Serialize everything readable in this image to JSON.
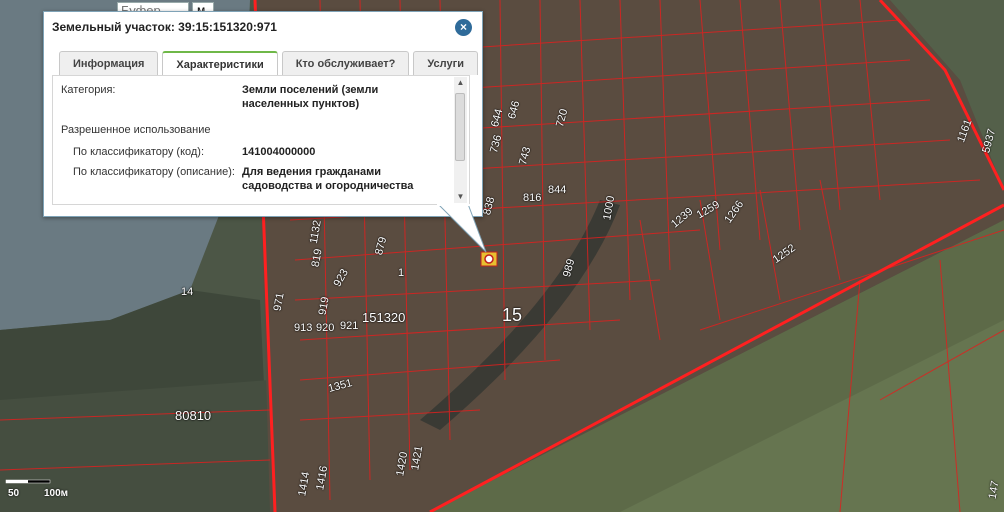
{
  "buffer": {
    "placeholder": "Буфер",
    "unit": "м."
  },
  "popup": {
    "title": "Земельный участок: 39:15:151320:971",
    "close_symbol": "×",
    "tabs": [
      {
        "label": "Информация",
        "active": false
      },
      {
        "label": "Характеристики",
        "active": true
      },
      {
        "label": "Кто обслуживает?",
        "active": false
      },
      {
        "label": "Услуги",
        "active": false
      }
    ],
    "rows": {
      "category_label": "Категория:",
      "category_value_1": "Земли поселений (земли",
      "category_value_2": "населенных пунктов)",
      "permitted_use_label": "Разрешенное использование",
      "classifier_code_label": "По классификатору (код):",
      "classifier_code_value": "141004000000",
      "classifier_desc_label": "По классификатору (описание):",
      "classifier_desc_value_1": "Для ведения гражданами",
      "classifier_desc_value_2": "садоводства и огородничества"
    }
  },
  "map": {
    "labels": [
      "646",
      "644",
      "736",
      "720",
      "743",
      "816",
      "844",
      "1000",
      "1239",
      "1259",
      "1266",
      "1161",
      "5937",
      "838",
      "879",
      "1",
      "923",
      "1132",
      "819",
      "14",
      "971",
      "919",
      "913",
      "920",
      "921",
      "151320",
      "15",
      "989",
      "1252",
      "1351",
      "80810",
      "1421",
      "1420",
      "1416",
      "1414",
      "147"
    ],
    "parcel_color": "#e0201e",
    "boundary_color": "#ff2020"
  },
  "scale": {
    "label_50": "50",
    "label_100": "100м"
  }
}
